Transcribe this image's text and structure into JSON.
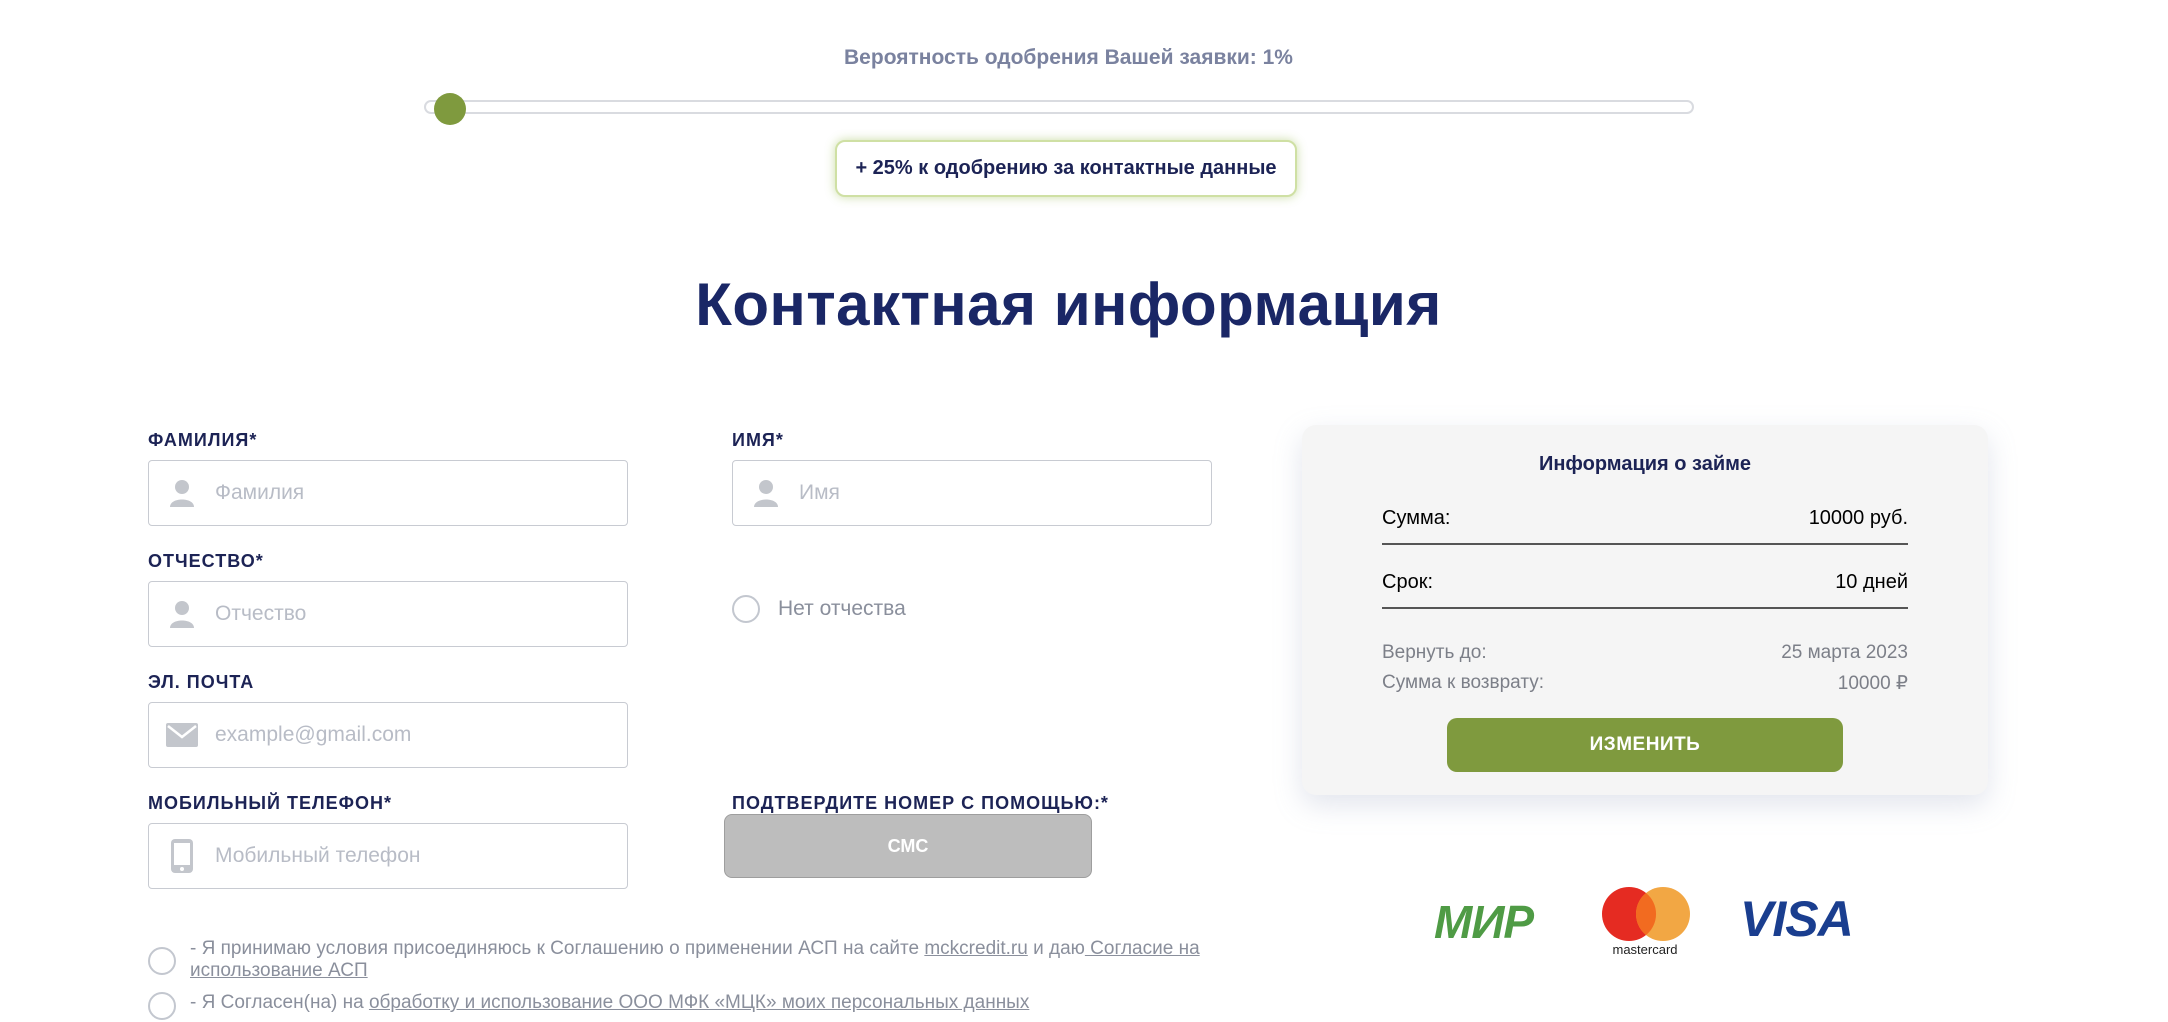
{
  "progress": {
    "label": "Вероятность одобрения Вашей заявки: 1%",
    "value_percent": 1,
    "bonus_text": "+ 25% к одобрению за контактные данные"
  },
  "page_title": "Контактная информация",
  "form": {
    "last_name": {
      "label": "ФАМИЛИЯ*",
      "placeholder": "Фамилия"
    },
    "first_name": {
      "label": "ИМЯ*",
      "placeholder": "Имя"
    },
    "patronymic": {
      "label": "ОТЧЕСТВО*",
      "placeholder": "Отчество"
    },
    "no_patronymic": "Нет отчества",
    "email": {
      "label": "ЭЛ. ПОЧТА",
      "placeholder": "example@gmail.com"
    },
    "phone": {
      "label": "МОБИЛЬНЫЙ ТЕЛЕФОН*",
      "placeholder": "Мобильный телефон"
    },
    "confirm": {
      "label": "ПОДТВЕРДИТЕ НОМЕР С ПОМОЩЬЮ:*",
      "button": "СМС"
    }
  },
  "consents": {
    "c1_prefix": "- Я принимаю условия присоединяюсь к Соглашению о применении АСП на сайте ",
    "c1_link1": "mckcredit.ru",
    "c1_mid": " и даю",
    "c1_link2": " Согласие на использование АСП",
    "c2_prefix": "- Я Согласен(на) на ",
    "c2_link": "обработку и использование ООО МФК «МЦК» моих персональных данных"
  },
  "loan": {
    "title": "Информация о займе",
    "amount_label": "Сумма:",
    "amount_value": "10000 руб.",
    "term_label": "Срок:",
    "term_value": "10 дней",
    "return_by_label": "Вернуть до:",
    "return_by_value": "25 марта 2023",
    "return_sum_label": "Сумма к возврату:",
    "return_sum_value": "10000 ₽",
    "change_button": "ИЗМЕНИТЬ"
  },
  "payment_logos": {
    "mir": "МИР",
    "mastercard": "mastercard",
    "visa": "VISA"
  },
  "colors": {
    "accent_green": "#7f9a3e",
    "title_navy": "#1a2766"
  },
  "icons": {
    "person": "user-icon",
    "mail": "envelope-icon",
    "phone": "phone-icon"
  }
}
